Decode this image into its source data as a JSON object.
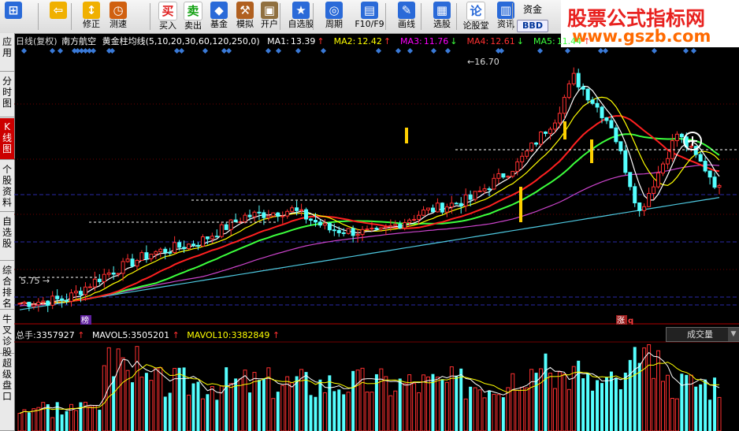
{
  "toolbar": {
    "items": [
      {
        "label": "",
        "icon": "nav-icon"
      },
      {
        "label": "",
        "icon": "back-arrow-icon"
      },
      {
        "label": "修正",
        "icon": "adjust-icon"
      },
      {
        "label": "测速",
        "icon": "clock-icon"
      },
      {
        "label": "买入",
        "icon": "buy-icon",
        "glyph": "买"
      },
      {
        "label": "卖出",
        "icon": "sell-icon",
        "glyph": "卖"
      },
      {
        "label": "基金",
        "icon": "fund-icon"
      },
      {
        "label": "模拟",
        "icon": "hammer-icon"
      },
      {
        "label": "开户",
        "icon": "lock-icon"
      },
      {
        "label": "自选股",
        "icon": "star-icon"
      },
      {
        "label": "周期",
        "icon": "cycle-icon"
      },
      {
        "label": "F10/F9",
        "icon": "f10-icon"
      },
      {
        "label": "画线",
        "icon": "pen-icon"
      },
      {
        "label": "选股",
        "icon": "screen-icon"
      },
      {
        "label": "论股堂",
        "icon": "forum-icon",
        "glyph": "论"
      },
      {
        "label": "资讯",
        "icon": "news-icon"
      }
    ],
    "zijin_label": "资金",
    "bbd_label": "BBD"
  },
  "brand": {
    "title": "股票公式指标网",
    "url": "www.gszb.com"
  },
  "sidebar": {
    "tabs": [
      {
        "label": "应用",
        "active": false
      },
      {
        "label": "分时图",
        "active": false
      },
      {
        "label": "K线图",
        "active": true
      },
      {
        "label": "个股资料",
        "active": false
      },
      {
        "label": "自选股",
        "active": false
      },
      {
        "label": "综合排名",
        "active": false
      },
      {
        "label": "牛叉诊股",
        "active": false
      },
      {
        "label": "超级盘口",
        "active": false
      }
    ]
  },
  "header": {
    "period": "日线(复权)",
    "stock": "南方航空",
    "indicator": "黄金柱均线(5,10,20,30,60,120,250,0)",
    "ma": [
      {
        "label": "MA1:",
        "value": "13.39",
        "dir": "↑",
        "color": "#ffffff"
      },
      {
        "label": "MA2:",
        "value": "12.42",
        "dir": "↑",
        "color": "#ffff00"
      },
      {
        "label": "MA3:",
        "value": "11.76",
        "dir": "↓",
        "color": "#ff00ff"
      },
      {
        "label": "MA4:",
        "value": "12.61",
        "dir": "↓",
        "color": "#ff3030"
      },
      {
        "label": "MA5:",
        "value": "11.44",
        "dir": "↑",
        "color": "#3cff3c"
      }
    ]
  },
  "chart_data": [
    {
      "type": "candlestick",
      "annotations": {
        "high_label": "16.70",
        "low_label": "5.75"
      },
      "markers": {
        "bottom_left": "榜",
        "bottom_right_1": "涨",
        "bottom_right_2": "q"
      },
      "price_range": [
        5.0,
        17.5
      ]
    },
    {
      "type": "bar",
      "title": "总手:",
      "values": {
        "vol": "3357927",
        "mavol5": "3505201",
        "mavol10": "3382849"
      },
      "labels": {
        "mavol5": "MAVOL5:",
        "mavol10": "MAVOL10:"
      },
      "selector_value": "成交量"
    }
  ],
  "colors": {
    "up": "#ff3030",
    "down": "#54ffff",
    "ma5": "#ffffff",
    "ma10": "#ffff00",
    "ma20": "#ff2020",
    "ma60": "#3cff3c",
    "ma120": "#cc44cc",
    "ma250": "#4ec8e0"
  }
}
